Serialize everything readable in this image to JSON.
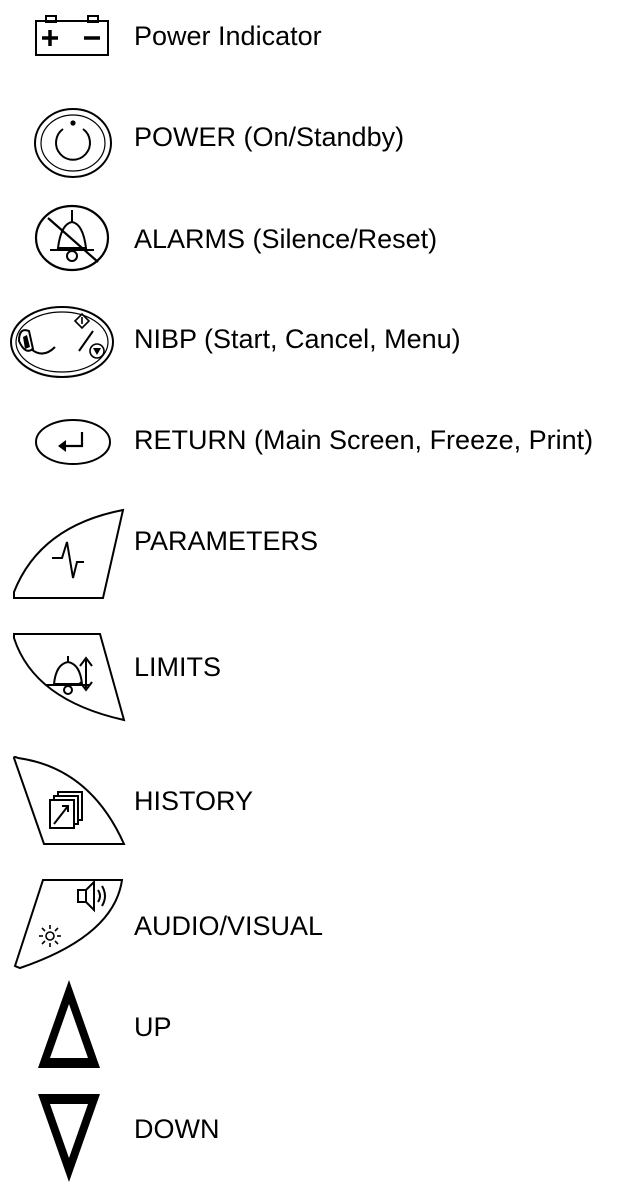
{
  "legend": [
    {
      "icon": "battery-icon",
      "label": "Power Indicator"
    },
    {
      "icon": "power-icon",
      "label": "POWER (On/Standby)"
    },
    {
      "icon": "alarm-silence-icon",
      "label": "ALARMS (Silence/Reset)"
    },
    {
      "icon": "nibp-cuff-icon",
      "label": "NIBP (Start, Cancel, Menu)"
    },
    {
      "icon": "return-arrow-icon",
      "label": "RETURN (Main Screen, Freeze, Print)"
    },
    {
      "icon": "waveform-icon",
      "label": "PARAMETERS"
    },
    {
      "icon": "alarm-limits-icon",
      "label": "LIMITS"
    },
    {
      "icon": "history-pages-icon",
      "label": "HISTORY"
    },
    {
      "icon": "speaker-brightness-icon",
      "label": "AUDIO/VISUAL"
    },
    {
      "icon": "up-triangle-icon",
      "label": "UP"
    },
    {
      "icon": "down-triangle-icon",
      "label": "DOWN"
    }
  ]
}
